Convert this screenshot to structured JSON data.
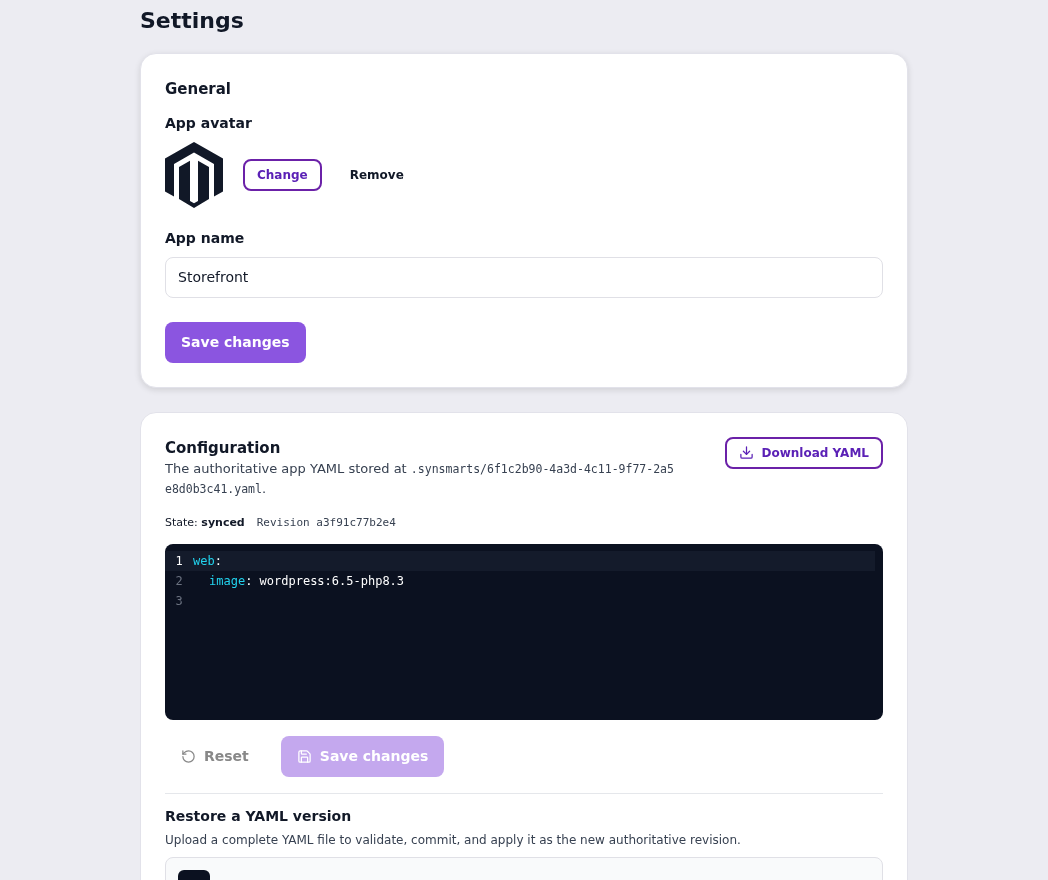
{
  "page": {
    "title": "Settings"
  },
  "general": {
    "title": "General",
    "avatar_label": "App avatar",
    "change_button": "Change",
    "remove_button": "Remove",
    "name_label": "App name",
    "name_value": "Storefront",
    "save_button": "Save changes"
  },
  "configuration": {
    "title": "Configuration",
    "description": "The authoritative app YAML stored at",
    "path": ".synsmarts/6f1c2b90-4a3d-4c11-9f77-2a5e8d0b3c41.yaml",
    "path_suffix": ".",
    "download_button": "Download YAML",
    "state_label": "State:",
    "state_value": "synced",
    "revision": "Revision a3f91c77b2e4",
    "code_lines": [
      {
        "number": "1",
        "active": true,
        "indented": false,
        "tokens": [
          {
            "kind": "key",
            "text": "web"
          },
          {
            "kind": "plain",
            "text": ":"
          }
        ]
      },
      {
        "number": "2",
        "active": false,
        "indented": true,
        "tokens": [
          {
            "kind": "key",
            "text": "image"
          },
          {
            "kind": "plain",
            "text": ": wordpress:6.5-php8.3"
          }
        ]
      },
      {
        "number": "3",
        "active": false
      }
    ],
    "reset_button": "Reset",
    "save_button": "Save changes",
    "save_disabled": true
  },
  "restore": {
    "title": "Restore a YAML version",
    "description": "Upload a complete YAML file to validate, commit, and apply it as the new authoritative revision."
  }
}
